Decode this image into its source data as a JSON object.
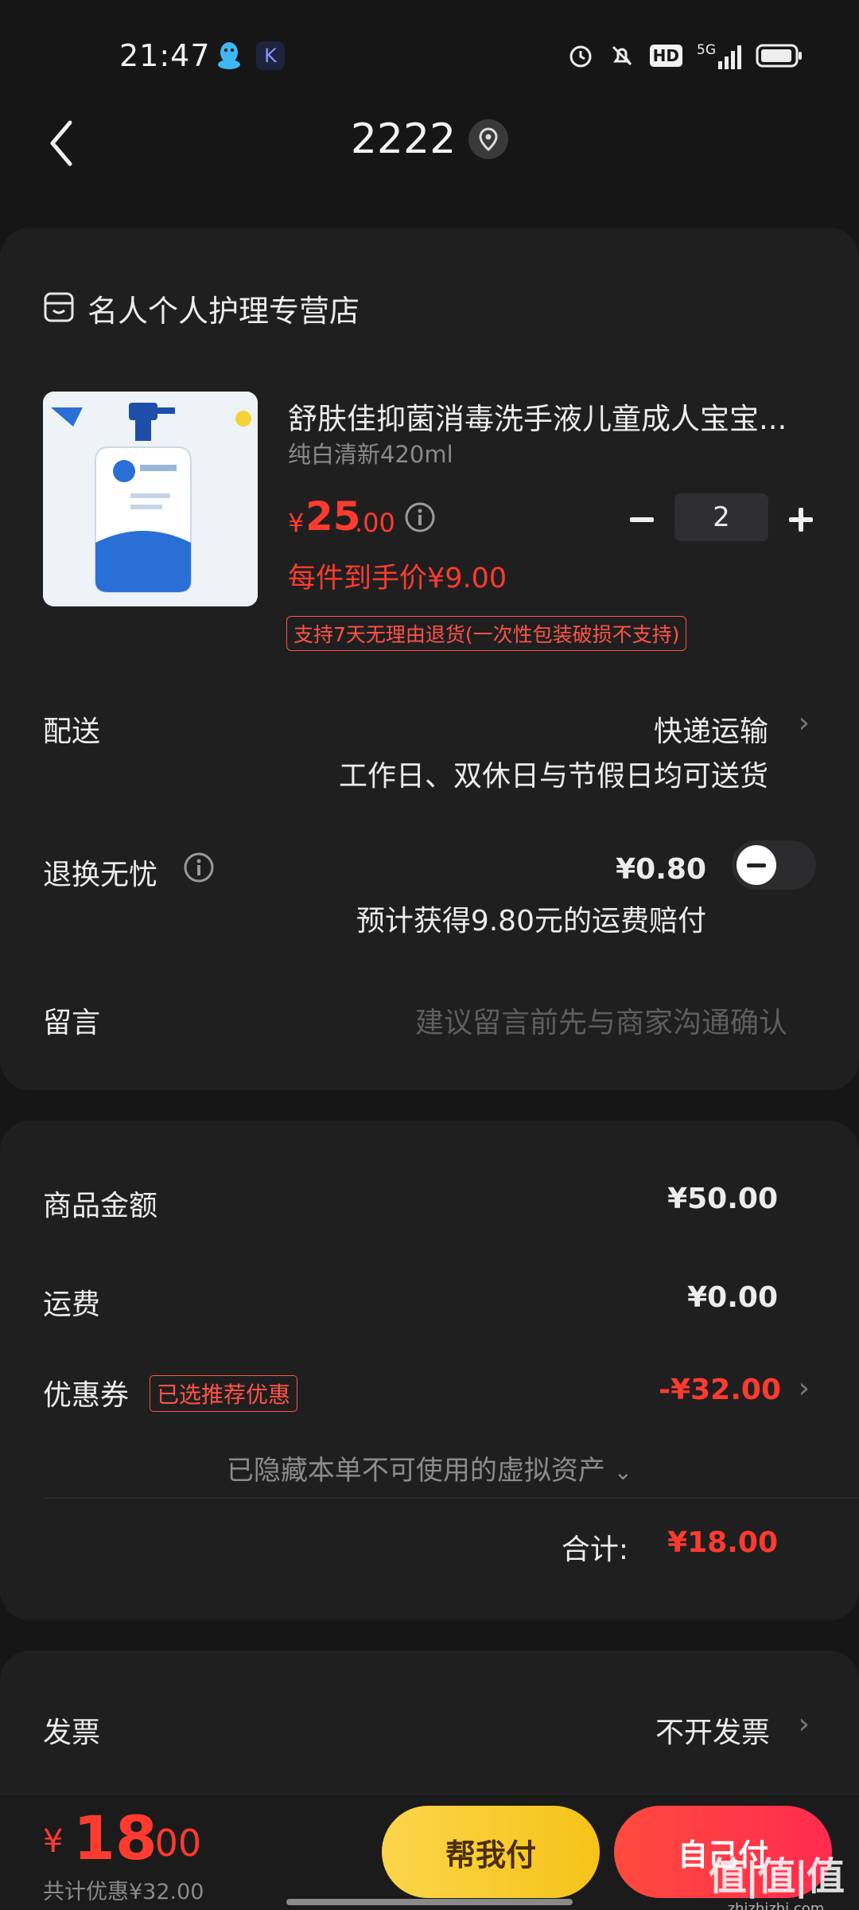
{
  "status_bar": {
    "time": "21:47",
    "network": "5G",
    "hd_badge": "HD",
    "app_icon_glyph": "K",
    "icons": [
      "qq-icon",
      "app-icon",
      "alarm-icon",
      "mute-icon",
      "hd-icon",
      "signal-icon",
      "battery-icon"
    ]
  },
  "header": {
    "title": "2222"
  },
  "store": {
    "name": "名人个人护理专营店"
  },
  "product": {
    "title": "舒肤佳抑菌消毒洗手液儿童成人宝宝...",
    "spec": "纯白清新420ml",
    "price_currency": "¥",
    "price_integer": "25",
    "price_decimal": ".00",
    "per_item_price": "每件到手价¥9.00",
    "return_policy": "支持7天无理由退货(一次性包装破损不支持)",
    "quantity": "2"
  },
  "delivery": {
    "label": "配送",
    "method": "快递运输",
    "note": "工作日、双休日与节假日均可送货"
  },
  "worry_free": {
    "label": "退换无忧",
    "price": "¥0.80",
    "note": "预计获得9.80元的运费赔付",
    "enabled": false
  },
  "message": {
    "label": "留言",
    "placeholder": "建议留言前先与商家沟通确认"
  },
  "summary": {
    "goods_label": "商品金额",
    "goods_value": "¥50.00",
    "shipping_label": "运费",
    "shipping_value": "¥0.00",
    "coupon_label": "优惠券",
    "coupon_tag": "已选推荐优惠",
    "coupon_value": "-¥32.00",
    "hidden_assets": "已隐藏本单不可使用的虚拟资产",
    "total_label": "合计:",
    "total_value": "¥18.00"
  },
  "invoice": {
    "label": "发票",
    "value": "不开发票"
  },
  "bottom": {
    "currency": "¥",
    "total_integer": "18",
    "total_decimal": ".00",
    "discount_note": "共计优惠¥32.00",
    "help_pay": "帮我付",
    "self_pay": "自己付"
  },
  "watermark": {
    "big": "值|值|值",
    "small": "zhizhizhi.com"
  },
  "colors": {
    "accent_red": "#ff3b2f",
    "help_button": "#f7c928",
    "background": "#161616",
    "card": "#1f1f20"
  }
}
